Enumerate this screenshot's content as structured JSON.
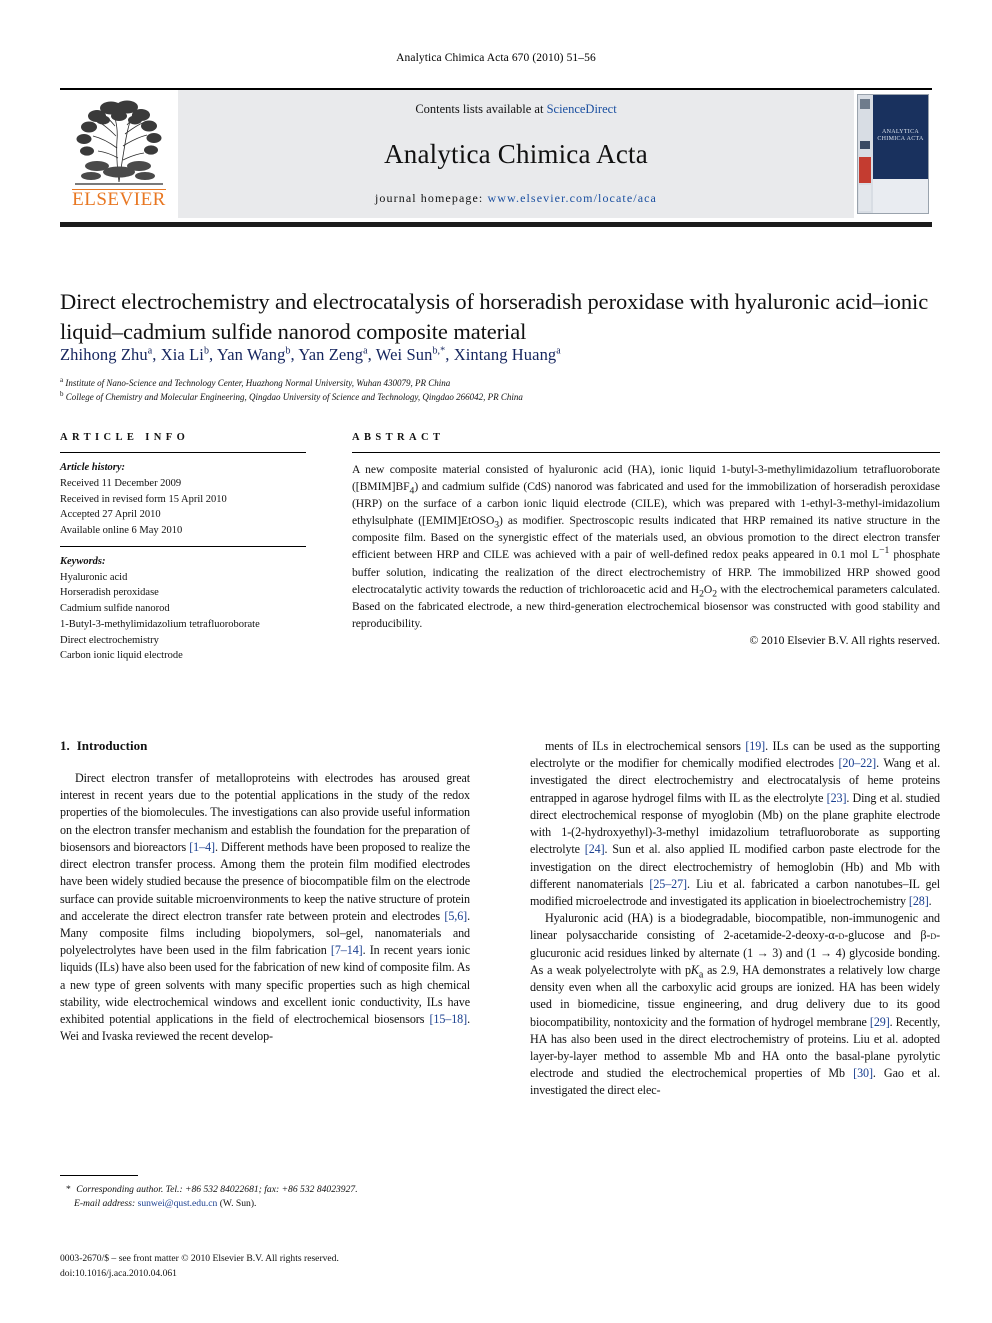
{
  "running_head": "Analytica Chimica Acta 670 (2010) 51–56",
  "masthead": {
    "publisher_name": "ELSEVIER",
    "contents_prefix": "Contents lists available at ",
    "sciencedirect": "ScienceDirect",
    "journal_title": "Analytica Chimica Acta",
    "homepage_label": "journal homepage:",
    "homepage_url": "www.elsevier.com/locate/aca",
    "cover_title": "ANALYTICA CHIMICA ACTA",
    "sciencedirect_color": "#1a4fa0",
    "elsevier_orange": "#E87722"
  },
  "article": {
    "title": "Direct electrochemistry and electrocatalysis of horseradish peroxidase with hyaluronic acid–ionic liquid–cadmium sulfide nanorod composite material",
    "authors_html": "Zhihong Zhu<sup>a</sup>, Xia Li<sup>b</sup>, Yan Wang<sup>b</sup>, Yan Zeng<sup>a</sup>, Wei Sun<sup>b,</sup><sup>*</sup>, Xintang Huang<sup>a</sup>",
    "affiliation_a": "Institute of Nano-Science and Technology Center, Huazhong Normal University, Wuhan 430079, PR China",
    "affiliation_b": "College of Chemistry and Molecular Engineering, Qingdao University of Science and Technology, Qingdao 266042, PR China"
  },
  "article_info": {
    "heading": "ARTICLE INFO",
    "history_label": "Article history:",
    "history": [
      "Received 11 December 2009",
      "Received in revised form 15 April 2010",
      "Accepted 27 April 2010",
      "Available online 6 May 2010"
    ],
    "keywords_label": "Keywords:",
    "keywords": [
      "Hyaluronic acid",
      "Horseradish peroxidase",
      "Cadmium sulfide nanorod",
      "1-Butyl-3-methylimidazolium tetrafluoroborate",
      "Direct electrochemistry",
      "Carbon ionic liquid electrode"
    ]
  },
  "abstract": {
    "heading": "ABSTRACT",
    "text_html": "A new composite material consisted of hyaluronic acid (HA), ionic liquid 1-butyl-3-methylimidazolium tetrafluoroborate ([BMIM]BF<sub>4</sub>) and cadmium sulfide (CdS) nanorod was fabricated and used for the immobilization of horseradish peroxidase (HRP) on the surface of a carbon ionic liquid electrode (CILE), which was prepared with 1-ethyl-3-methyl-imidazolium ethylsulphate ([EMIM]EtOSO<sub>3</sub>) as modifier. Spectroscopic results indicated that HRP remained its native structure in the composite film. Based on the synergistic effect of the materials used, an obvious promotion to the direct electron transfer efficient between HRP and CILE was achieved with a pair of well-defined redox peaks appeared in 0.1 mol L<sup>−1</sup> phosphate buffer solution, indicating the realization of the direct electrochemistry of HRP. The immobilized HRP showed good electrocatalytic activity towards the reduction of trichloroacetic acid and H<sub>2</sub>O<sub>2</sub> with the electrochemical parameters calculated. Based on the fabricated electrode, a new third-generation electrochemical biosensor was constructed with good stability and reproducibility.",
    "copyright": "© 2010 Elsevier B.V. All rights reserved."
  },
  "introduction": {
    "heading_number": "1.",
    "heading_text": "Introduction",
    "left_paragraph_html": "Direct electron transfer of metalloproteins with electrodes has aroused great interest in recent years due to the potential applications in the study of the redox properties of the biomolecules. The investigations can also provide useful information on the electron transfer mechanism and establish the foundation for the preparation of biosensors and bioreactors <span class=\"ref\">[1–4]</span>. Different methods have been proposed to realize the direct electron transfer process. Among them the protein film modified electrodes have been widely studied because the presence of biocompatible film on the electrode surface can provide suitable microenvironments to keep the native structure of protein and accelerate the direct electron transfer rate between protein and electrodes <span class=\"ref\">[5,6]</span>. Many composite films including biopolymers, sol–gel, nanomaterials and polyelectrolytes have been used in the film fabrication <span class=\"ref\">[7–14]</span>. In recent years ionic liquids (ILs) have also been used for the fabrication of new kind of composite film. As a new type of green solvents with many specific properties such as high chemical stability, wide electrochemical windows and excellent ionic conductivity, ILs have exhibited potential applications in the field of electrochemical biosensors <span class=\"ref\">[15–18]</span>. Wei and Ivaska reviewed the recent develop-",
    "right_paragraph1_html": "ments of ILs in electrochemical sensors <span class=\"ref\">[19]</span>. ILs can be used as the supporting electrolyte or the modifier for chemically modified electrodes <span class=\"ref\">[20–22]</span>. Wang et al. investigated the direct electrochemistry and electrocatalysis of heme proteins entrapped in agarose hydrogel films with IL as the electrolyte <span class=\"ref\">[23]</span>. Ding et al. studied direct electrochemical response of myoglobin (Mb) on the plane graphite electrode with 1-(2-hydroxyethyl)-3-methyl imidazolium tetrafluoroborate as supporting electrolyte <span class=\"ref\">[24]</span>. Sun et al. also applied IL modified carbon paste electrode for the investigation on the direct electrochemistry of hemoglobin (Hb) and Mb with different nanomaterials <span class=\"ref\">[25–27]</span>. Liu et al. fabricated a carbon nanotubes–IL gel modified microelectrode and investigated its application in bioelectrochemistry <span class=\"ref\">[28]</span>.",
    "right_paragraph2_html": "Hyaluronic acid (HA) is a biodegradable, biocompatible, non-immunogenic and linear polysaccharide consisting of 2-acetamide-2-deoxy-α-<span style=\"font-variant:small-caps\">d</span>-glucose and β-<span style=\"font-variant:small-caps\">d</span>-glucuronic acid residues linked by alternate (1 → 3) and (1 → 4) glycoside bonding. As a weak polyelectrolyte with p<i>K</i><sub>a</sub> as 2.9, HA demonstrates a relatively low charge density even when all the carboxylic acid groups are ionized. HA has been widely used in biomedicine, tissue engineering, and drug delivery due to its good biocompatibility, nontoxicity and the formation of hydrogel membrane <span class=\"ref\">[29]</span>. Recently, HA has also been used in the direct electrochemistry of proteins. Liu et al. adopted layer-by-layer method to assemble Mb and HA onto the basal-plane pyrolytic electrode and studied the electrochemical properties of Mb <span class=\"ref\">[30]</span>. Gao et al. investigated the direct elec-"
  },
  "footnote": {
    "corresponding_html": "<span class=\"star\">*</span> <span class=\"it\">Corresponding author. Tel.: +86 532 84022681; fax: +86 532 84023927.</span>",
    "email_label": "E-mail address:",
    "email": "sunwei@qust.edu.cn",
    "email_suffix": "(W. Sun)."
  },
  "page_footer": {
    "front_matter": "0003-2670/$ – see front matter © 2010 Elsevier B.V. All rights reserved.",
    "doi": "doi:10.1016/j.aca.2010.04.061"
  }
}
